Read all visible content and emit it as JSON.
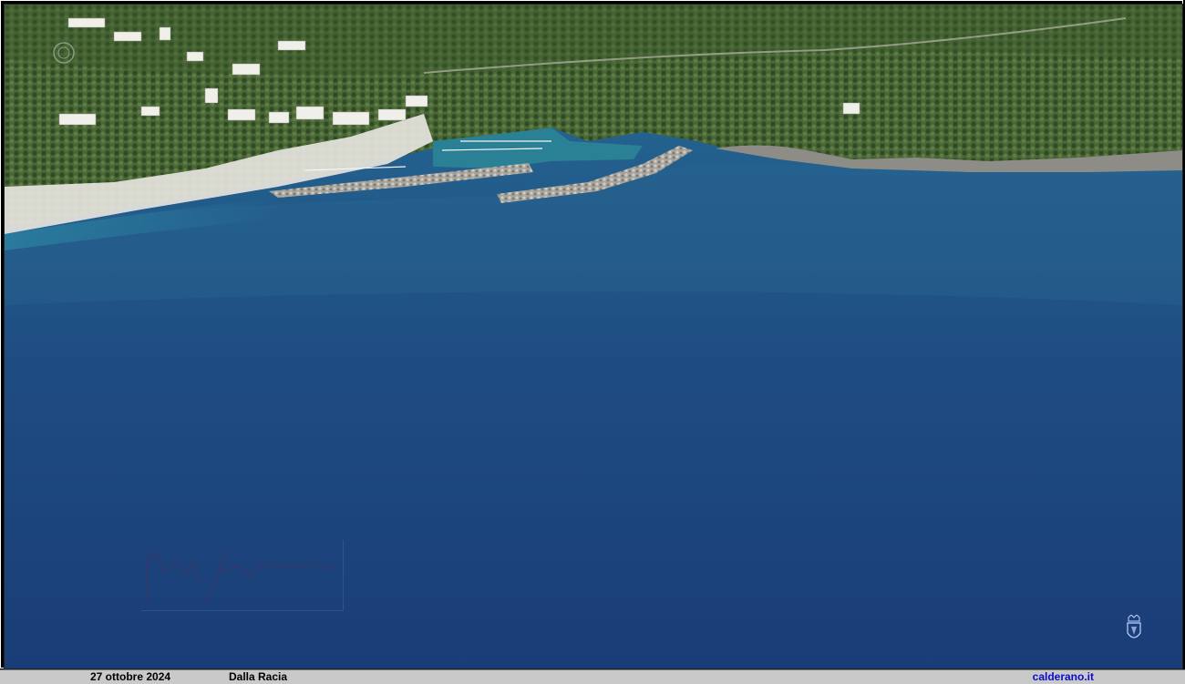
{
  "photo": {
    "subject": "aerial-coastal-harbor-view",
    "colors": {
      "sea_deep": "#1d3f78",
      "sea_mid": "#2a5d8f",
      "sea_shallow": "#2f8fa6",
      "vegetation": "#4d6b3a",
      "rock": "#9a9a96",
      "buildings": "#e8e6e0"
    }
  },
  "caption": {
    "date": "27 ottobre 2024",
    "place": "Dalla Racia",
    "site": "calderano.it",
    "site_color": "#0b0bd0"
  },
  "overlays": {
    "signature_icon": "handwritten-signature",
    "crest_icon": "coat-of-arms-icon",
    "top_left_watermark_icon": "seal-watermark-icon"
  }
}
